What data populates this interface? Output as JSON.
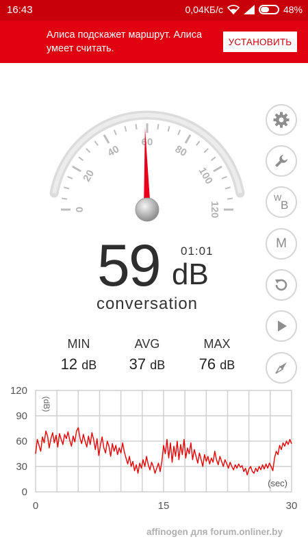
{
  "status_bar": {
    "time": "16:43",
    "network_speed": "0,04КБ/с",
    "battery": "48%",
    "icons": [
      "wifi-icon",
      "signal-icon",
      "battery-icon"
    ]
  },
  "ad": {
    "text": "Алиса подскажет маршрут. Алиса умеет считать.",
    "button": "УСТАНОВИТЬ",
    "background": "#e1000f"
  },
  "gauge": {
    "ticks": [
      "0",
      "20",
      "40",
      "60",
      "80",
      "100",
      "120"
    ],
    "min": 0,
    "max": 120,
    "needle_value": 59,
    "needle_color": "#e8001c"
  },
  "reading": {
    "value": "59",
    "unit": "dB",
    "timer": "01:01",
    "label": "conversation"
  },
  "stats": {
    "min": {
      "label": "MIN",
      "value": "12",
      "unit": "dB"
    },
    "avg": {
      "label": "AVG",
      "value": "37",
      "unit": "dB"
    },
    "max": {
      "label": "MAX",
      "value": "76",
      "unit": "dB"
    }
  },
  "side_buttons": [
    {
      "name": "settings",
      "icon": "gear-icon"
    },
    {
      "name": "tools",
      "icon": "wrench-icon"
    },
    {
      "name": "weighting",
      "icon": "wb-icon",
      "text_top": "W",
      "text_bottom": "B"
    },
    {
      "name": "memory",
      "icon": "m-icon",
      "text": "M"
    },
    {
      "name": "reset",
      "icon": "reset-icon"
    },
    {
      "name": "play",
      "icon": "play-icon"
    },
    {
      "name": "compass",
      "icon": "compass-icon"
    }
  ],
  "chart_data": {
    "type": "line",
    "x_unit": "(sec)",
    "y_unit": "(dB)",
    "xlim": [
      0,
      30
    ],
    "ylim": [
      0,
      120
    ],
    "x_ticks": [
      "0",
      "15",
      "30"
    ],
    "y_ticks": [
      "0",
      "30",
      "60",
      "90",
      "120"
    ],
    "grid": true,
    "line_color": "#e60000",
    "series": [
      {
        "values": [
          [
            0,
            45
          ],
          [
            0.2,
            62
          ],
          [
            0.4,
            55
          ],
          [
            0.6,
            48
          ],
          [
            0.8,
            65
          ],
          [
            1.0,
            58
          ],
          [
            1.2,
            72
          ],
          [
            1.4,
            66
          ],
          [
            1.6,
            52
          ],
          [
            1.8,
            63
          ],
          [
            2.0,
            70
          ],
          [
            2.2,
            58
          ],
          [
            2.4,
            67
          ],
          [
            2.6,
            53
          ],
          [
            2.8,
            69
          ],
          [
            3.0,
            62
          ],
          [
            3.2,
            56
          ],
          [
            3.4,
            68
          ],
          [
            3.6,
            63
          ],
          [
            3.8,
            71
          ],
          [
            4.0,
            61
          ],
          [
            4.2,
            54
          ],
          [
            4.4,
            66
          ],
          [
            4.6,
            59
          ],
          [
            4.8,
            72
          ],
          [
            5.0,
            76
          ],
          [
            5.2,
            64
          ],
          [
            5.4,
            57
          ],
          [
            5.6,
            68
          ],
          [
            5.8,
            60
          ],
          [
            6.0,
            53
          ],
          [
            6.2,
            66
          ],
          [
            6.4,
            56
          ],
          [
            6.6,
            70
          ],
          [
            6.8,
            62
          ],
          [
            7.0,
            50
          ],
          [
            7.2,
            63
          ],
          [
            7.4,
            43
          ],
          [
            7.6,
            55
          ],
          [
            7.8,
            65
          ],
          [
            8.0,
            52
          ],
          [
            8.2,
            46
          ],
          [
            8.4,
            60
          ],
          [
            8.6,
            54
          ],
          [
            8.8,
            42
          ],
          [
            9.0,
            57
          ],
          [
            9.2,
            48
          ],
          [
            9.4,
            55
          ],
          [
            9.6,
            44
          ],
          [
            9.8,
            52
          ],
          [
            10.0,
            46
          ],
          [
            10.2,
            58
          ],
          [
            10.4,
            47
          ],
          [
            10.6,
            40
          ],
          [
            10.8,
            33
          ],
          [
            11.0,
            42
          ],
          [
            11.2,
            30
          ],
          [
            11.4,
            36
          ],
          [
            11.6,
            25
          ],
          [
            11.8,
            32
          ],
          [
            12.0,
            22
          ],
          [
            12.2,
            34
          ],
          [
            12.4,
            28
          ],
          [
            12.6,
            38
          ],
          [
            12.8,
            30
          ],
          [
            13.0,
            42
          ],
          [
            13.2,
            32
          ],
          [
            13.4,
            26
          ],
          [
            13.6,
            35
          ],
          [
            13.8,
            30
          ],
          [
            14.0,
            22
          ],
          [
            14.2,
            28
          ],
          [
            14.4,
            34
          ],
          [
            14.6,
            24
          ],
          [
            14.8,
            36
          ],
          [
            15.0,
            55
          ],
          [
            15.2,
            45
          ],
          [
            15.4,
            62
          ],
          [
            15.6,
            40
          ],
          [
            15.8,
            58
          ],
          [
            16.0,
            35
          ],
          [
            16.2,
            54
          ],
          [
            16.4,
            42
          ],
          [
            16.6,
            60
          ],
          [
            16.8,
            38
          ],
          [
            17.0,
            56
          ],
          [
            17.2,
            44
          ],
          [
            17.4,
            62
          ],
          [
            17.6,
            40
          ],
          [
            17.8,
            52
          ],
          [
            18.0,
            45
          ],
          [
            18.2,
            58
          ],
          [
            18.4,
            38
          ],
          [
            18.6,
            50
          ],
          [
            18.8,
            42
          ],
          [
            19.0,
            34
          ],
          [
            19.2,
            46
          ],
          [
            19.4,
            38
          ],
          [
            19.6,
            30
          ],
          [
            19.8,
            44
          ],
          [
            20.0,
            36
          ],
          [
            20.2,
            42
          ],
          [
            20.4,
            33
          ],
          [
            20.6,
            40
          ],
          [
            20.8,
            35
          ],
          [
            21.0,
            48
          ],
          [
            21.2,
            38
          ],
          [
            21.4,
            32
          ],
          [
            21.6,
            42
          ],
          [
            21.8,
            36
          ],
          [
            22.0,
            30
          ],
          [
            22.2,
            38
          ],
          [
            22.4,
            33
          ],
          [
            22.6,
            28
          ],
          [
            22.8,
            35
          ],
          [
            23.0,
            30
          ],
          [
            23.2,
            26
          ],
          [
            23.4,
            32
          ],
          [
            23.6,
            28
          ],
          [
            23.8,
            33
          ],
          [
            24.0,
            29
          ],
          [
            24.2,
            31
          ],
          [
            24.4,
            24
          ],
          [
            24.6,
            28
          ],
          [
            24.8,
            20
          ],
          [
            25.0,
            27
          ],
          [
            25.2,
            30
          ],
          [
            25.4,
            24
          ],
          [
            25.6,
            22
          ],
          [
            25.8,
            28
          ],
          [
            26.0,
            24
          ],
          [
            26.2,
            30
          ],
          [
            26.4,
            26
          ],
          [
            26.6,
            32
          ],
          [
            26.8,
            27
          ],
          [
            27.0,
            33
          ],
          [
            27.2,
            28
          ],
          [
            27.4,
            34
          ],
          [
            27.6,
            30
          ],
          [
            27.8,
            25
          ],
          [
            28.0,
            40
          ],
          [
            28.2,
            48
          ],
          [
            28.4,
            44
          ],
          [
            28.6,
            55
          ],
          [
            28.8,
            50
          ],
          [
            29.0,
            58
          ],
          [
            29.2,
            54
          ],
          [
            29.4,
            60
          ],
          [
            29.6,
            56
          ],
          [
            29.8,
            62
          ],
          [
            30.0,
            57
          ]
        ]
      }
    ]
  },
  "watermark": "affinogen для forum.onliner.by"
}
